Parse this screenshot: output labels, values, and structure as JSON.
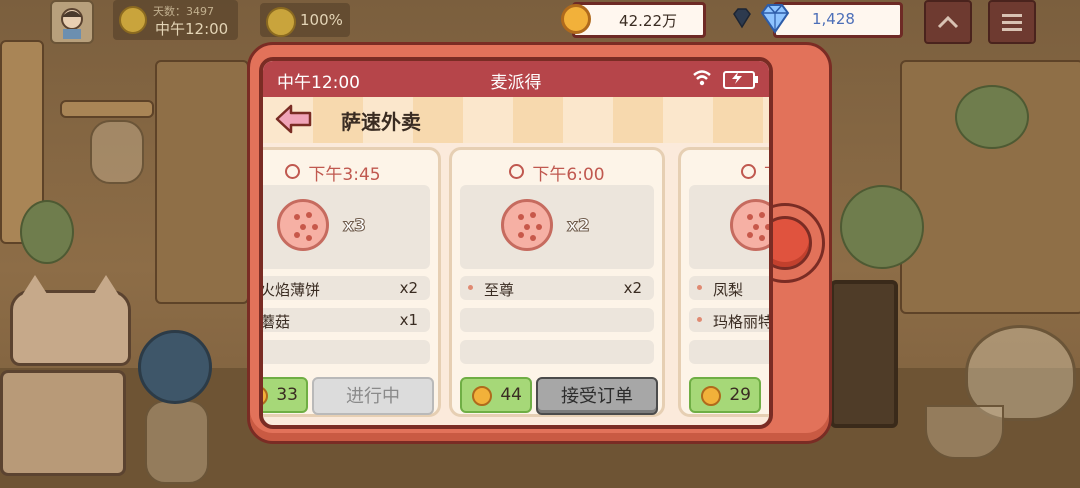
{
  "hud": {
    "days_label": "天数：3497",
    "time": "中午12:00",
    "mood": "100%",
    "coins": "42.22万",
    "gems": "1,428"
  },
  "phone": {
    "status_time": "中午12:00",
    "status_title": "麦派得",
    "app_title": "萨速外卖"
  },
  "orders": [
    {
      "due": "下午3:45",
      "pizza_qty": "x3",
      "items": [
        {
          "name": "火焰薄饼",
          "qty": "x2"
        },
        {
          "name": "蘑菇",
          "qty": "x1"
        }
      ],
      "reward": "33",
      "action": "进行中"
    },
    {
      "due": "下午6:00",
      "pizza_qty": "x2",
      "items": [
        {
          "name": "至尊",
          "qty": "x2"
        }
      ],
      "reward": "44",
      "action": "接受订单"
    },
    {
      "due": "下午",
      "items": [
        {
          "name": "凤梨",
          "qty": ""
        },
        {
          "name": "玛格丽特",
          "qty": ""
        }
      ],
      "reward": "29"
    }
  ],
  "colors": {
    "phone_body": "#e2725a",
    "status_bar": "#b6454a",
    "reward_green": "#a6d878",
    "due_red": "#c0584f"
  }
}
